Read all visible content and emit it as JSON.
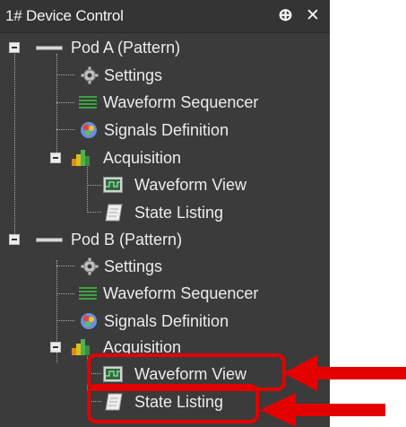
{
  "panel": {
    "title": "1# Device Control",
    "pin_glyph": "ⴲ",
    "close_glyph": "✕"
  },
  "tree": {
    "pod_a": {
      "label": "Pod A (Pattern)",
      "settings": "Settings",
      "waveform_sequencer": "Waveform Sequencer",
      "signals_definition": "Signals Definition",
      "acquisition": "Acquisition",
      "waveform_view": "Waveform View",
      "state_listing": "State Listing"
    },
    "pod_b": {
      "label": "Pod B (Pattern)",
      "settings": "Settings",
      "waveform_sequencer": "Waveform Sequencer",
      "signals_definition": "Signals Definition",
      "acquisition": "Acquisition",
      "waveform_view": "Waveform View",
      "state_listing": "State Listing"
    }
  },
  "colors": {
    "panel_bg": "#3b3b3b",
    "text": "#ececec",
    "annotation": "#e50000"
  },
  "icons": [
    "pod-connector-icon",
    "gear-icon",
    "waveform-sequencer-icon",
    "signals-definition-icon",
    "acquisition-icon",
    "waveform-view-icon",
    "state-listing-icon",
    "pin-icon",
    "close-icon"
  ]
}
